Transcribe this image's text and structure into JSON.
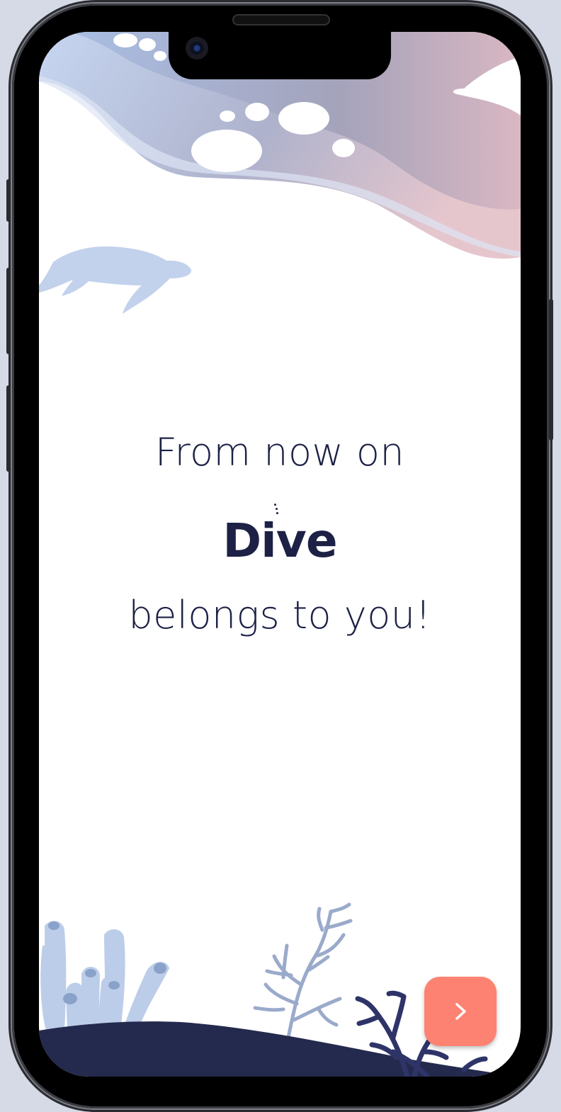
{
  "onboarding": {
    "line1": "From now on",
    "brand": "Dive",
    "line3": "belongs to you!"
  },
  "next_button": {
    "icon": "chevron-right-icon",
    "color": "#fe8272"
  },
  "colors": {
    "text": "#1c2145",
    "wave_light": "#c3d3ee",
    "wave_dark": "#9aa5c4",
    "wave_pink": "#e9c7cf",
    "seabed": "#242a4d",
    "coral_light": "#b7cbe9",
    "coral_mid": "#9aaacb",
    "coral_dark": "#2e3468"
  },
  "icons": {
    "turtle": "turtle-icon",
    "wave": "ocean-wave-decoration",
    "seabed": "seabed-decoration",
    "coral": "coral-decoration"
  }
}
